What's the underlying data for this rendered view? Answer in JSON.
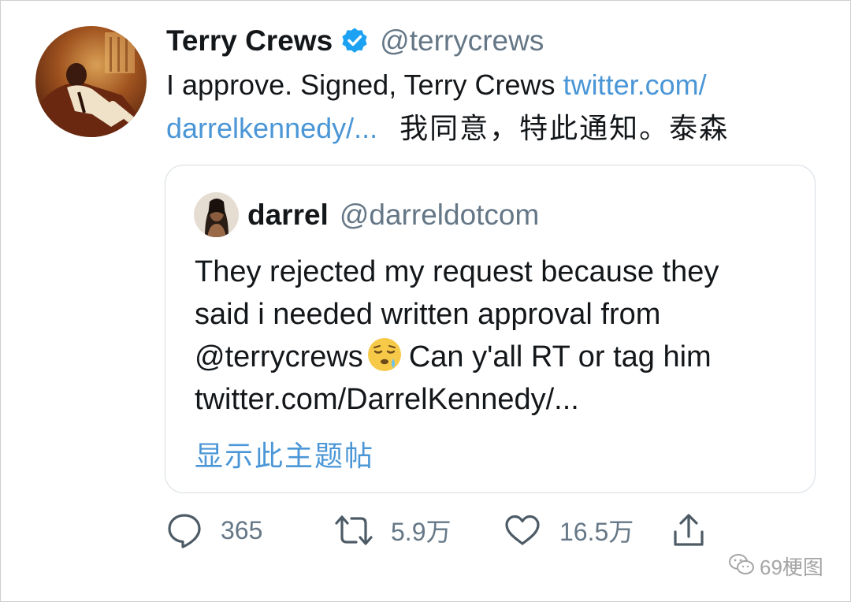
{
  "tweet": {
    "author_name": "Terry Crews",
    "author_handle": "@terrycrews",
    "text_part1": "I approve. Signed, Terry Crews ",
    "link_part1": "twitter.com/",
    "link_part2": "darrelkennedy/...",
    "text_chinese": "我同意，特此通知。泰森"
  },
  "quoted_tweet": {
    "author_name": "darrel",
    "author_handle": "@darreldotcom",
    "line1": "They rejected my request because they",
    "line2": "said i needed written approval from",
    "line3_part1": "@terrycrews",
    "line3_part2": "Can y'all RT or tag him",
    "line4": "twitter.com/DarrelKennedy/...",
    "emoji": "sleepy-face-emoji",
    "show_thread": "显示此主题帖"
  },
  "actions": {
    "reply_count": "365",
    "retweet_count": "5.9万",
    "like_count": "16.5万"
  },
  "watermark": {
    "text": "69梗图"
  },
  "colors": {
    "link": "#4a96d6",
    "muted": "#657786",
    "text": "#14171a",
    "verified": "#1da1f2",
    "card_border": "#d6dde3"
  }
}
